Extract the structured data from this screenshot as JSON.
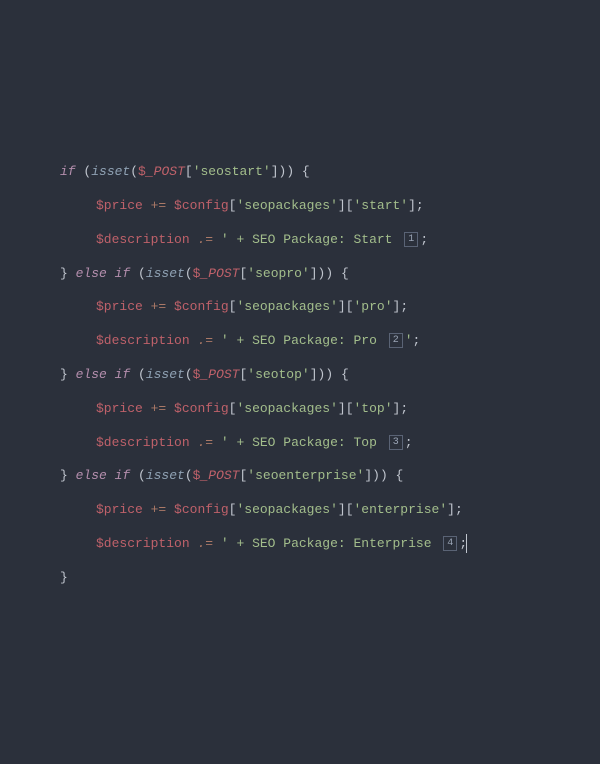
{
  "code": {
    "lines": [
      {
        "indent": 0,
        "tokens": [
          {
            "c": "kw",
            "t": "if"
          },
          {
            "c": "paren",
            "t": " ("
          },
          {
            "c": "fn",
            "t": "isset"
          },
          {
            "c": "paren",
            "t": "("
          },
          {
            "c": "var",
            "t": "$"
          },
          {
            "c": "vsp",
            "t": "_POST"
          },
          {
            "c": "brack",
            "t": "["
          },
          {
            "c": "str",
            "t": "'seostart'"
          },
          {
            "c": "brack",
            "t": "]"
          },
          {
            "c": "paren",
            "t": "))"
          },
          {
            "c": "brace",
            "t": " {"
          }
        ]
      },
      {
        "indent": 1,
        "tokens": [
          {
            "c": "var",
            "t": "$price"
          },
          {
            "c": "op",
            "t": " "
          },
          {
            "c": "assn",
            "t": "+="
          },
          {
            "c": "op",
            "t": " "
          },
          {
            "c": "var",
            "t": "$config"
          },
          {
            "c": "brack",
            "t": "["
          },
          {
            "c": "str",
            "t": "'seopackages'"
          },
          {
            "c": "brack",
            "t": "]["
          },
          {
            "c": "str",
            "t": "'start'"
          },
          {
            "c": "brack",
            "t": "]"
          },
          {
            "c": "punc",
            "t": ";"
          }
        ]
      },
      {
        "indent": 1,
        "tokens": [
          {
            "c": "var",
            "t": "$description"
          },
          {
            "c": "op",
            "t": " "
          },
          {
            "c": "assn",
            "t": ".="
          },
          {
            "c": "op",
            "t": " "
          },
          {
            "c": "str",
            "t": "' + SEO Package: Start "
          },
          {
            "c": "badge",
            "t": "1"
          },
          {
            "c": "punc",
            "t": ";"
          }
        ]
      },
      {
        "indent": 0,
        "tokens": [
          {
            "c": "brace",
            "t": "} "
          },
          {
            "c": "kw",
            "t": "else if"
          },
          {
            "c": "paren",
            "t": " ("
          },
          {
            "c": "fn",
            "t": "isset"
          },
          {
            "c": "paren",
            "t": "("
          },
          {
            "c": "var",
            "t": "$"
          },
          {
            "c": "vsp",
            "t": "_POST"
          },
          {
            "c": "brack",
            "t": "["
          },
          {
            "c": "str",
            "t": "'seopro'"
          },
          {
            "c": "brack",
            "t": "]"
          },
          {
            "c": "paren",
            "t": "))"
          },
          {
            "c": "brace",
            "t": " {"
          }
        ]
      },
      {
        "indent": 1,
        "tokens": [
          {
            "c": "var",
            "t": "$price"
          },
          {
            "c": "op",
            "t": " "
          },
          {
            "c": "assn",
            "t": "+="
          },
          {
            "c": "op",
            "t": " "
          },
          {
            "c": "var",
            "t": "$config"
          },
          {
            "c": "brack",
            "t": "["
          },
          {
            "c": "str",
            "t": "'seopackages'"
          },
          {
            "c": "brack",
            "t": "]["
          },
          {
            "c": "str",
            "t": "'pro'"
          },
          {
            "c": "brack",
            "t": "]"
          },
          {
            "c": "punc",
            "t": ";"
          }
        ]
      },
      {
        "indent": 1,
        "tokens": [
          {
            "c": "var",
            "t": "$description"
          },
          {
            "c": "op",
            "t": " "
          },
          {
            "c": "assn",
            "t": ".="
          },
          {
            "c": "op",
            "t": " "
          },
          {
            "c": "str",
            "t": "' + SEO Package: Pro "
          },
          {
            "c": "badge",
            "t": "2"
          },
          {
            "c": "str",
            "t": "'"
          },
          {
            "c": "punc",
            "t": ";"
          }
        ]
      },
      {
        "indent": 0,
        "tokens": [
          {
            "c": "brace",
            "t": "} "
          },
          {
            "c": "kw",
            "t": "else if"
          },
          {
            "c": "paren",
            "t": " ("
          },
          {
            "c": "fn",
            "t": "isset"
          },
          {
            "c": "paren",
            "t": "("
          },
          {
            "c": "var",
            "t": "$"
          },
          {
            "c": "vsp",
            "t": "_POST"
          },
          {
            "c": "brack",
            "t": "["
          },
          {
            "c": "str",
            "t": "'seotop'"
          },
          {
            "c": "brack",
            "t": "]"
          },
          {
            "c": "paren",
            "t": "))"
          },
          {
            "c": "brace",
            "t": " {"
          }
        ]
      },
      {
        "indent": 1,
        "tokens": [
          {
            "c": "var",
            "t": "$price"
          },
          {
            "c": "op",
            "t": " "
          },
          {
            "c": "assn",
            "t": "+="
          },
          {
            "c": "op",
            "t": " "
          },
          {
            "c": "var",
            "t": "$config"
          },
          {
            "c": "brack",
            "t": "["
          },
          {
            "c": "str",
            "t": "'seopackages'"
          },
          {
            "c": "brack",
            "t": "]["
          },
          {
            "c": "str",
            "t": "'top'"
          },
          {
            "c": "brack",
            "t": "]"
          },
          {
            "c": "punc",
            "t": ";"
          }
        ]
      },
      {
        "indent": 1,
        "tokens": [
          {
            "c": "var",
            "t": "$description"
          },
          {
            "c": "op",
            "t": " "
          },
          {
            "c": "assn",
            "t": ".="
          },
          {
            "c": "op",
            "t": " "
          },
          {
            "c": "str",
            "t": "' + SEO Package: Top "
          },
          {
            "c": "badge",
            "t": "3"
          },
          {
            "c": "punc",
            "t": ";"
          }
        ]
      },
      {
        "indent": 0,
        "tokens": [
          {
            "c": "brace",
            "t": "} "
          },
          {
            "c": "kw",
            "t": "else if"
          },
          {
            "c": "paren",
            "t": " ("
          },
          {
            "c": "fn",
            "t": "isset"
          },
          {
            "c": "paren",
            "t": "("
          },
          {
            "c": "var",
            "t": "$"
          },
          {
            "c": "vsp",
            "t": "_POST"
          },
          {
            "c": "brack",
            "t": "["
          },
          {
            "c": "str",
            "t": "'seoenterprise'"
          },
          {
            "c": "brack",
            "t": "]"
          },
          {
            "c": "paren",
            "t": "))"
          },
          {
            "c": "brace",
            "t": " {"
          }
        ]
      },
      {
        "indent": 1,
        "tokens": [
          {
            "c": "var",
            "t": "$price"
          },
          {
            "c": "op",
            "t": " "
          },
          {
            "c": "assn",
            "t": "+="
          },
          {
            "c": "op",
            "t": " "
          },
          {
            "c": "var",
            "t": "$config"
          },
          {
            "c": "brack",
            "t": "["
          },
          {
            "c": "str",
            "t": "'seopackages'"
          },
          {
            "c": "brack",
            "t": "]["
          },
          {
            "c": "str",
            "t": "'enterprise'"
          },
          {
            "c": "brack",
            "t": "]"
          },
          {
            "c": "punc",
            "t": ";"
          }
        ]
      },
      {
        "indent": 1,
        "tokens": [
          {
            "c": "var",
            "t": "$description"
          },
          {
            "c": "op",
            "t": " "
          },
          {
            "c": "assn",
            "t": ".="
          },
          {
            "c": "op",
            "t": " "
          },
          {
            "c": "str",
            "t": "' + SEO Package: Enterprise "
          },
          {
            "c": "badge",
            "t": "4"
          },
          {
            "c": "punc",
            "t": ";"
          },
          {
            "c": "cursor",
            "t": ""
          }
        ]
      },
      {
        "indent": 0,
        "tokens": [
          {
            "c": "brace",
            "t": "}"
          }
        ]
      }
    ]
  }
}
